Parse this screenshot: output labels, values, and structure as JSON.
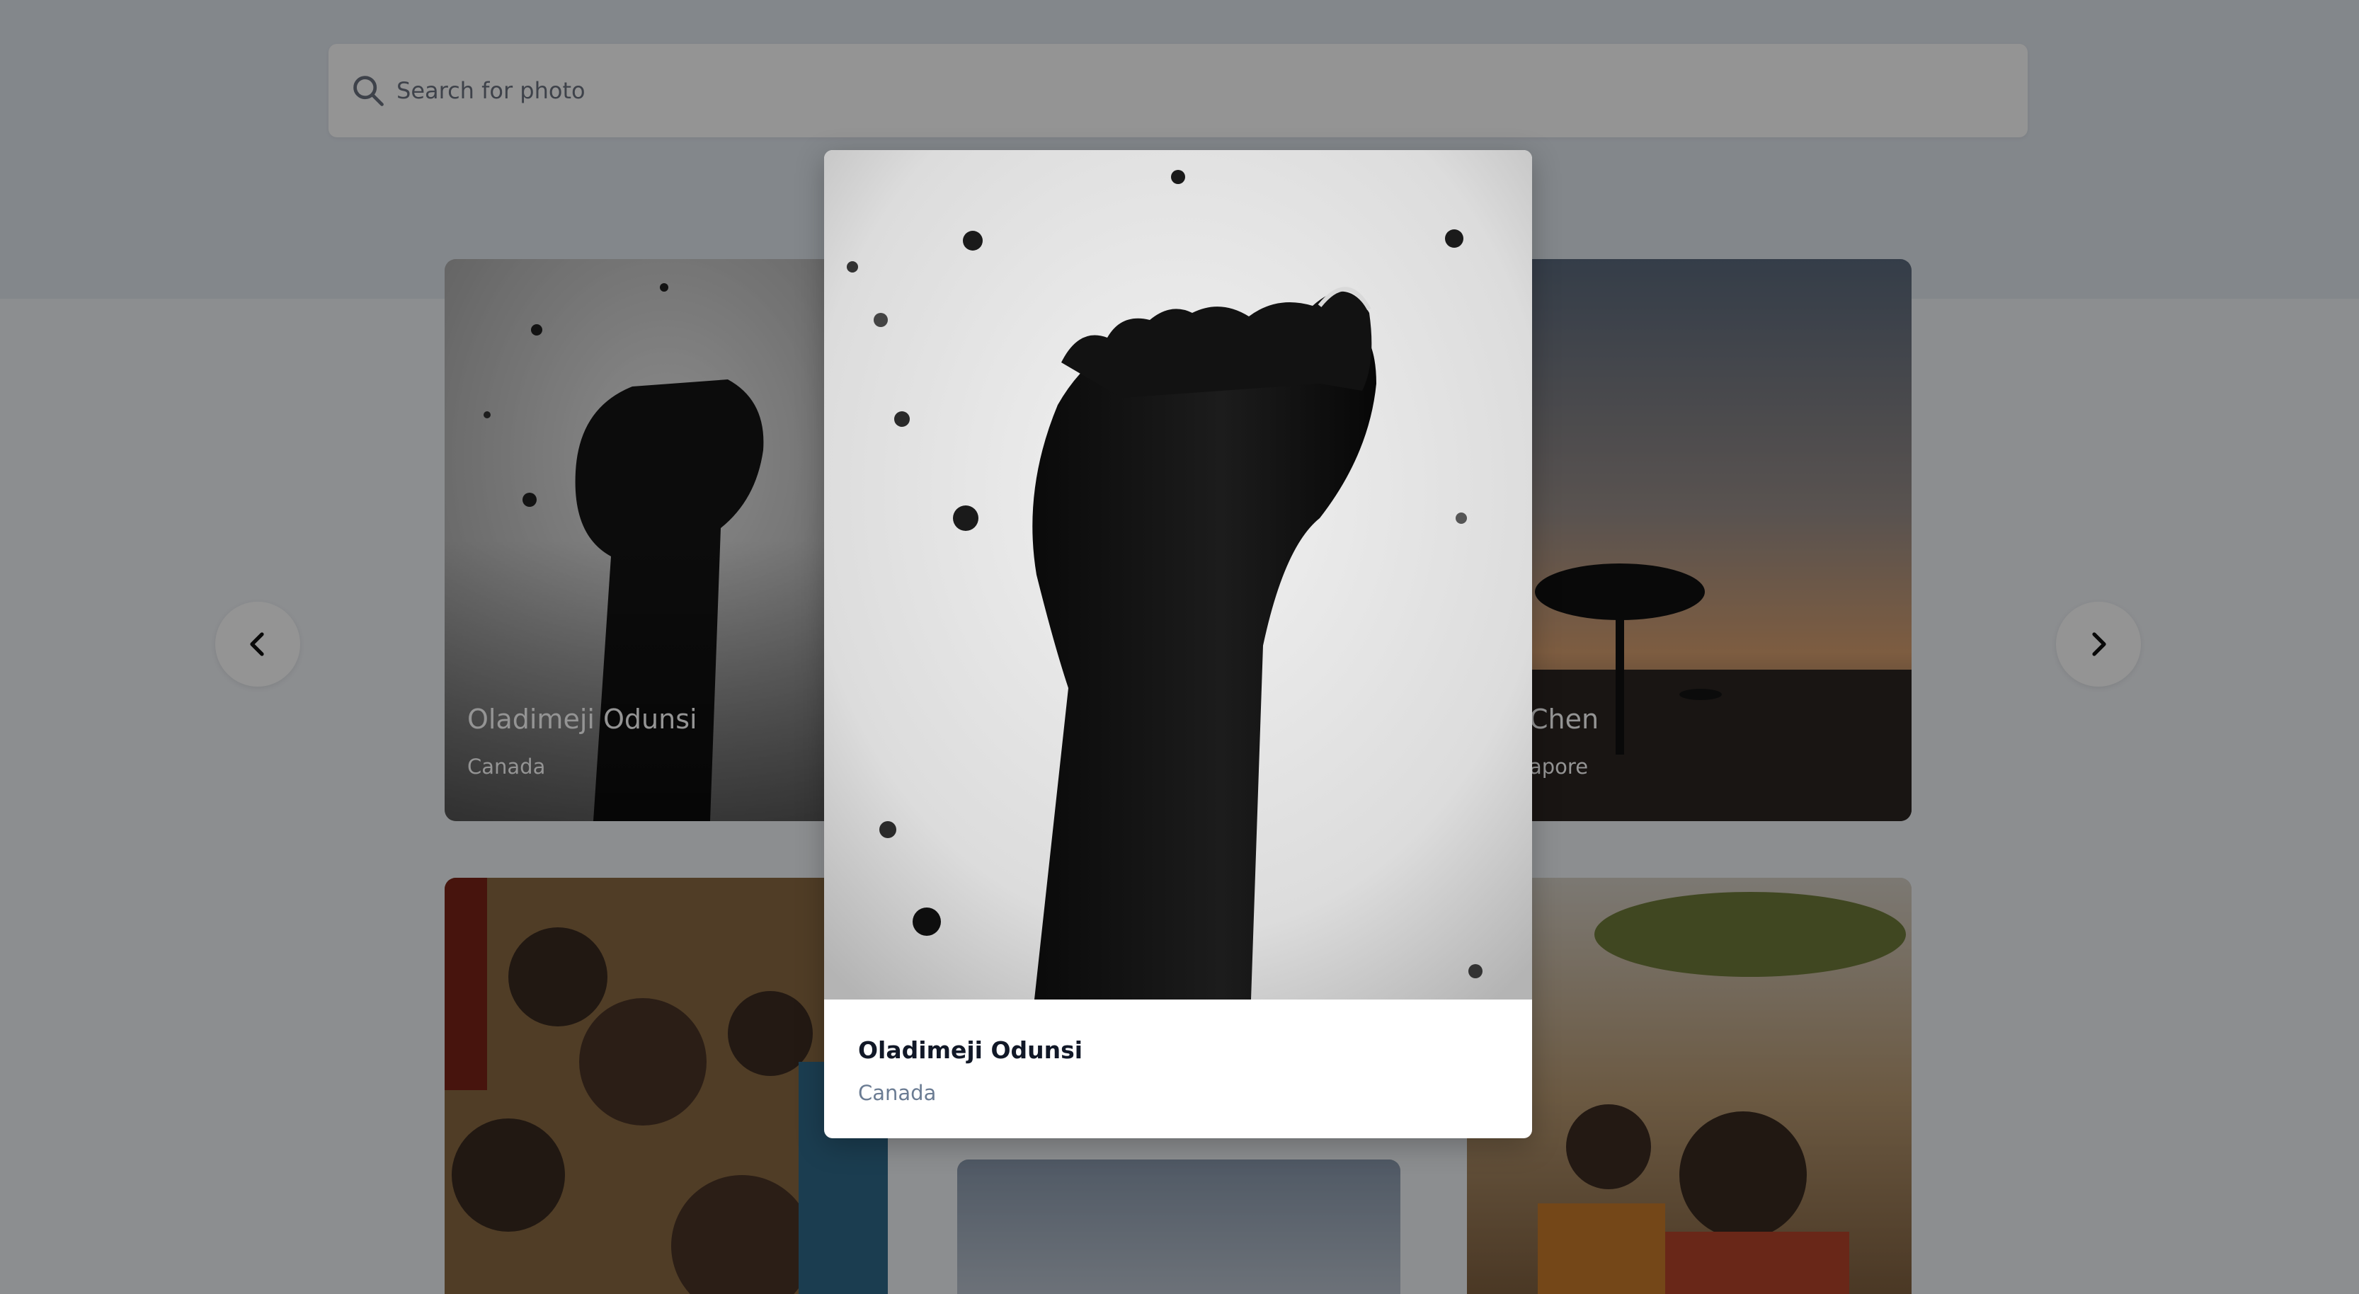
{
  "search": {
    "placeholder": "Search for photo",
    "icon": "search-icon"
  },
  "gallery": {
    "cards": [
      {
        "name": "Oladimeji Odunsi",
        "location": "Canada"
      },
      {
        "name": "Chen",
        "location": "apore"
      }
    ]
  },
  "nav": {
    "prev_icon": "chevron-left-icon",
    "next_icon": "chevron-right-icon"
  },
  "modal": {
    "name": "Oladimeji Odunsi",
    "location": "Canada"
  },
  "colors": {
    "header_band": "#e2e8f0",
    "page_bg": "#f1f4f8",
    "overlay": "rgba(0,0,0,0.42)",
    "modal_title": "#111827",
    "modal_subtitle": "#6b7c93"
  }
}
